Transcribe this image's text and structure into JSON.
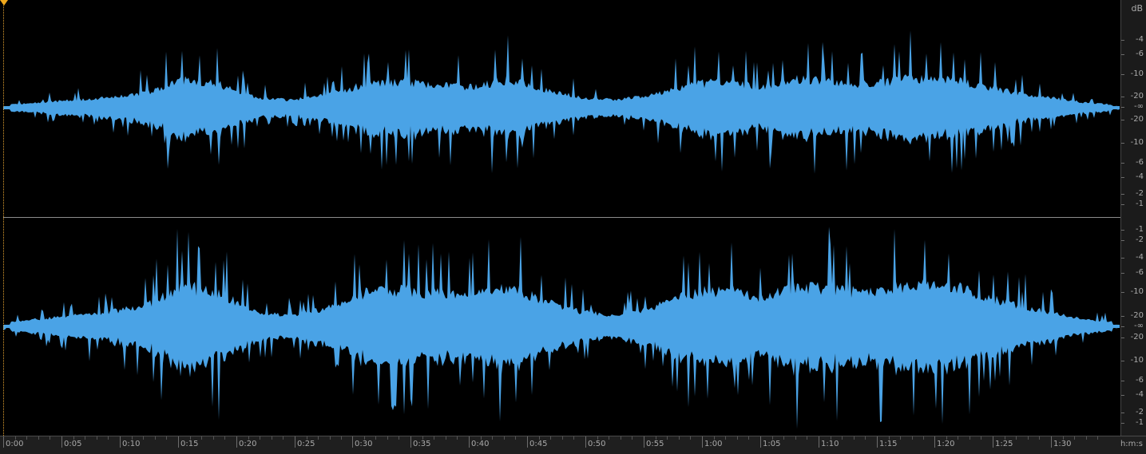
{
  "colors": {
    "background": "#000000",
    "waveform": "#4aa3e6",
    "playhead": "#f0a81c",
    "ruler_text": "#a9a9a9"
  },
  "db_ruler": {
    "unit": "dB",
    "top_channel_labels": [
      "-4",
      "-6",
      "-10",
      "-20",
      "-∞",
      "-20",
      "-10",
      "-6",
      "-4",
      "-2",
      "-1"
    ],
    "bottom_channel_labels": [
      "-1",
      "-2",
      "-4",
      "-6",
      "-10",
      "-20",
      "-∞",
      "-20",
      "-10",
      "-6",
      "-4",
      "-2",
      "-1"
    ]
  },
  "time_ruler": {
    "unit": "h:m:s",
    "labels": [
      "0:00",
      "0:05",
      "0:10",
      "0:15",
      "0:20",
      "0:25",
      "0:30",
      "0:35",
      "0:40",
      "0:45",
      "0:50",
      "0:55",
      "1:00",
      "1:05",
      "1:10",
      "1:15",
      "1:20",
      "1:25",
      "1:30"
    ]
  },
  "waveform": {
    "channels": [
      "left",
      "right"
    ],
    "envelope_peaks_normalized": [
      0.05,
      0.1,
      0.15,
      0.2,
      0.3,
      0.55,
      0.45,
      0.2,
      0.15,
      0.25,
      0.45,
      0.5,
      0.45,
      0.4,
      0.55,
      0.35,
      0.2,
      0.15,
      0.25,
      0.45,
      0.5,
      0.4,
      0.55,
      0.5,
      0.45,
      0.55,
      0.6,
      0.45,
      0.3,
      0.2,
      0.1,
      0.05
    ]
  }
}
